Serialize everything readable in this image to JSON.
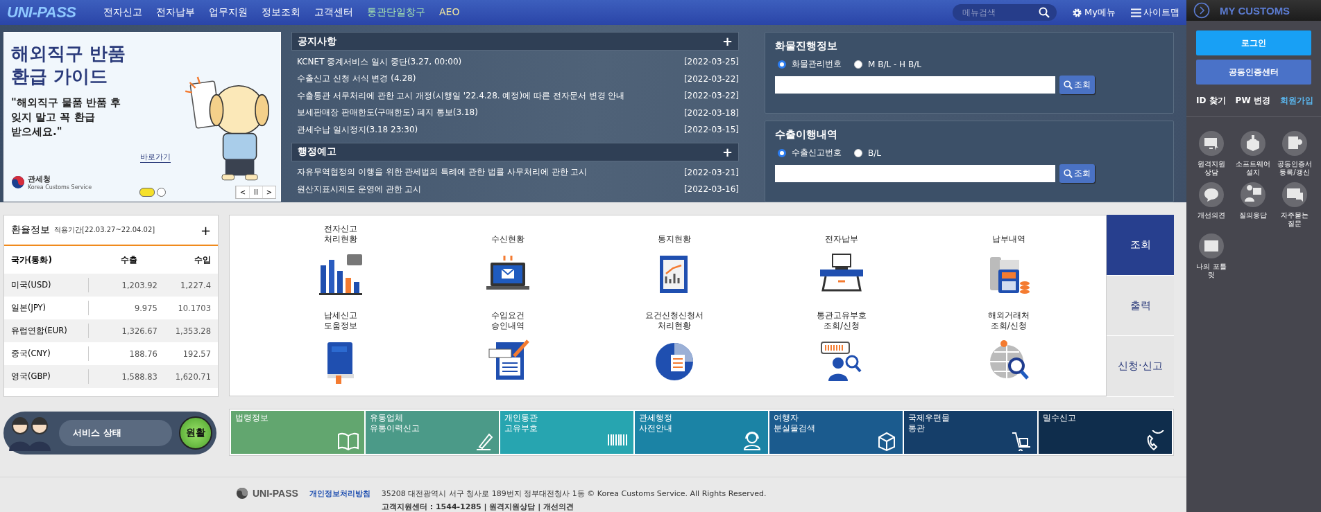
{
  "header": {
    "logo": "UNI-PASS",
    "nav": [
      {
        "label": "전자신고",
        "color": "#ffffff"
      },
      {
        "label": "전자납부",
        "color": "#ffffff"
      },
      {
        "label": "업무지원",
        "color": "#ffffff"
      },
      {
        "label": "정보조회",
        "color": "#ffffff"
      },
      {
        "label": "고객센터",
        "color": "#ffffff"
      },
      {
        "label": "통관단일창구",
        "color": "#a8e6b0"
      },
      {
        "label": "AEO",
        "color": "#f3e9a0"
      }
    ],
    "search": {
      "placeholder": "메뉴검색"
    },
    "my_menu": "My메뉴",
    "sitemap": "사이트맵"
  },
  "banner": {
    "title": [
      "해외직구 반품",
      "환급 가이드"
    ],
    "quote": [
      "\"해외직구 물품 반품 후",
      "잊지 말고 꼭 환급",
      "받으세요.\""
    ],
    "link": "바로가기",
    "agency": "관세청",
    "agency_en": "Korea Customs Service",
    "dots": [
      {
        "selected": true
      },
      {
        "selected": false
      }
    ],
    "controls": [
      "<",
      "II",
      ">"
    ]
  },
  "notices": {
    "title": "공지사항",
    "more": "+",
    "items": [
      {
        "text": "KCNET 중계서비스 일시 중단(3.27, 00:00)",
        "date": "[2022-03-25]"
      },
      {
        "text": "수출신고 신청 서식 변경 (4.28)",
        "date": "[2022-03-22]"
      },
      {
        "text": "수출통관 서무처리에 관한 고시 개정(시행일 '22.4.28. 예정)에 따른 전자문서 변경 안내",
        "date": "[2022-03-22]"
      },
      {
        "text": "보세판매장 판매한도(구매한도) 폐지 통보(3.18)",
        "date": "[2022-03-18]"
      },
      {
        "text": "관세수납 일시정지(3.18 23:30)",
        "date": "[2022-03-15]"
      }
    ]
  },
  "admin_notices": {
    "title": "행정예고",
    "more": "+",
    "items": [
      {
        "text": "자유무역협정의 이행을 위한 관세법의 특례에 관한 법률 사무처리에 관한 고시",
        "date": "[2022-03-21]"
      },
      {
        "text": "원산지표시제도 운영에 관한 고시",
        "date": "[2022-03-16]"
      }
    ]
  },
  "lookups": [
    {
      "title": "화물진행정보",
      "options": [
        {
          "label": "화물관리번호",
          "selected": true
        },
        {
          "label": "M B/L - H B/L",
          "selected": false
        }
      ],
      "button": "조회"
    },
    {
      "title": "수출이행내역",
      "options": [
        {
          "label": "수출신고번호",
          "selected": true
        },
        {
          "label": "B/L",
          "selected": false
        }
      ],
      "button": "조회"
    }
  ],
  "exchange": {
    "title": "환율정보",
    "period": "적용기간[22.03.27~22.04.02]",
    "more": "+",
    "columns": [
      "국가(통화)",
      "수출",
      "수입"
    ],
    "rows": [
      [
        "미국(USD)",
        "1,203.92",
        "1,227.4"
      ],
      [
        "일본(JPY)",
        "9.975",
        "10.1703"
      ],
      [
        "유럽연합(EUR)",
        "1,326.67",
        "1,353.28"
      ],
      [
        "중국(CNY)",
        "188.76",
        "192.57"
      ],
      [
        "영국(GBP)",
        "1,588.83",
        "1,620.71"
      ]
    ]
  },
  "services": [
    {
      "label": [
        "전자신고",
        "처리현황"
      ]
    },
    {
      "label": [
        "수신현황"
      ]
    },
    {
      "label": [
        "통지현황"
      ]
    },
    {
      "label": [
        "전자납부"
      ]
    },
    {
      "label": [
        "납부내역"
      ]
    },
    {
      "label": [
        "납세신고",
        "도움정보"
      ]
    },
    {
      "label": [
        "수입요건",
        "승인내역"
      ]
    },
    {
      "label": [
        "요건신청신청서",
        "처리현황"
      ]
    },
    {
      "label": [
        "통관고유부호",
        "조회/신청"
      ]
    },
    {
      "label": [
        "해외거래처",
        "조회/신청"
      ]
    }
  ],
  "service_tabs": [
    {
      "label": "조회",
      "selected": true
    },
    {
      "label": "출력",
      "selected": false
    },
    {
      "label": "신청·신고",
      "selected": false
    }
  ],
  "status": {
    "label": "서비스 상태",
    "value": "원활"
  },
  "quick_links": [
    {
      "label": [
        "법령정보"
      ],
      "color": "#62a66f"
    },
    {
      "label": [
        "유통업체",
        "유통이력신고"
      ],
      "color": "#4b9a88"
    },
    {
      "label": [
        "개인통관",
        "고유부호"
      ],
      "color": "#27a5b0"
    },
    {
      "label": [
        "관세행정",
        "사전안내"
      ],
      "color": "#1b83a5"
    },
    {
      "label": [
        "여행자",
        "분실물검색"
      ],
      "color": "#1b5b8e"
    },
    {
      "label": [
        "국제우편물",
        "통관"
      ],
      "color": "#153e69"
    },
    {
      "label": [
        "밀수신고"
      ],
      "color": "#0f2d4c"
    }
  ],
  "footer": {
    "logo": "UNI-PASS",
    "privacy": "개인정보처리방침",
    "address": "35208 대전광역시 서구 청사로 189번지 정부대전청사 1동 © Korea Customs Service. All Rights Reserved.",
    "contact": "고객지원센터 : 1544-1285 | 원격지원상담 | 개선의견"
  },
  "sidebar": {
    "title": "MY CUSTOMS",
    "login": "로그인",
    "cert": "공동인증센터",
    "links": [
      {
        "label": "ID 찾기",
        "color": "#ffffff"
      },
      {
        "label": "PW 변경",
        "color": "#ffffff"
      },
      {
        "label": "회원가입",
        "color": "#5bb8f0"
      }
    ],
    "tools": [
      {
        "label": [
          "원격지원",
          "상담"
        ]
      },
      {
        "label": [
          "소프트웨어",
          "설치"
        ]
      },
      {
        "label": [
          "공동인증서",
          "등록/갱신"
        ]
      },
      {
        "label": [
          "개선의견"
        ]
      },
      {
        "label": [
          "질의응답"
        ]
      },
      {
        "label": [
          "자주묻는",
          "질문"
        ]
      },
      {
        "label": [
          "나의 포틀",
          "릿"
        ]
      }
    ]
  }
}
